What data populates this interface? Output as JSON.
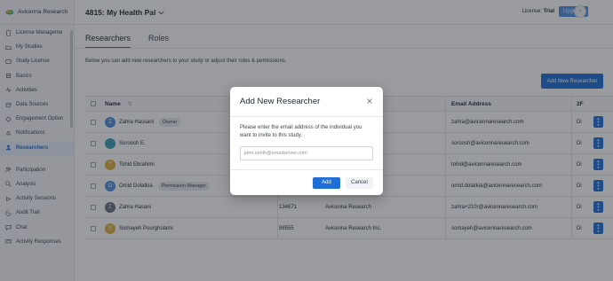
{
  "app": {
    "brand_name": "Avicenna Research",
    "study_title": "4815: My Health Pal",
    "license_label": "License:",
    "license_value": "Trial",
    "upgrade_label": "Upgrade",
    "accent": "#1f6fd6"
  },
  "sidebar": {
    "items": [
      {
        "label": "License Manageme",
        "icon": "document-icon"
      },
      {
        "label": "My Studies",
        "icon": "folder-icon"
      },
      {
        "label": "Study License",
        "icon": "license-icon"
      },
      {
        "label": "Basics",
        "icon": "basics-icon"
      },
      {
        "label": "Activities",
        "icon": "activities-icon"
      },
      {
        "label": "Data Sources",
        "icon": "data-sources-icon"
      },
      {
        "label": "Engagement Option",
        "icon": "engagement-icon"
      },
      {
        "label": "Notifications",
        "icon": "bell-icon"
      },
      {
        "label": "Researchers",
        "icon": "researchers-icon",
        "active": true
      },
      {
        "label": "Participation",
        "icon": "participation-icon"
      },
      {
        "label": "Analysis",
        "icon": "analysis-icon"
      },
      {
        "label": "Activity Sessions",
        "icon": "sessions-icon"
      },
      {
        "label": "Audit Trail",
        "icon": "audit-icon"
      },
      {
        "label": "Chat",
        "icon": "chat-icon"
      },
      {
        "label": "Activity Responses",
        "icon": "responses-icon"
      }
    ]
  },
  "tabs": [
    {
      "label": "Researchers",
      "active": true
    },
    {
      "label": "Roles",
      "active": false
    }
  ],
  "description": "Below you can add new researchers to your study or adjust their roles & permissions.",
  "add_new_label": "Add New Researcher",
  "table": {
    "columns": {
      "name": "Name",
      "email": "Email Address",
      "twofa": "2F"
    },
    "rows": [
      {
        "name": "Zahra Hassani",
        "role": "Owner",
        "id": "",
        "org": "",
        "email": "zahra@avicennaresearch.com",
        "twofa": "Di",
        "avatar_letter": "Z",
        "avatar_color": "#4f8fe0"
      },
      {
        "name": "Soroosh E.",
        "role": "",
        "id": "",
        "org": "",
        "email": "soroosh@avicennaresearch.com",
        "twofa": "Di",
        "avatar_letter": "",
        "avatar_color": "#3aa0b8"
      },
      {
        "name": "Tohid Ebrahimi",
        "role": "",
        "id": "",
        "org": "",
        "email": "tohid@avicennaresearch.com",
        "twofa": "Di",
        "avatar_letter": "T",
        "avatar_color": "#e0b03a"
      },
      {
        "name": "Omid Dolatkia",
        "role": "Permission Manager",
        "id": "",
        "org": "",
        "email": "omid.dolatkia@avicennaresearch.com",
        "twofa": "Di",
        "avatar_letter": "O",
        "avatar_color": "#4f8fe0"
      },
      {
        "name": "Zahra Hasani",
        "role": "",
        "id": "134671",
        "org": "Avicenna Research",
        "email": "zahra+210r@avicennaresearch.com",
        "twofa": "Di",
        "avatar_letter": "Z",
        "avatar_color": "#6b7280"
      },
      {
        "name": "Somayeh Pourgholami",
        "role": "",
        "id": "88555",
        "org": "Avicenna Research Inc.",
        "email": "somayeh@avicennaresearch.com",
        "twofa": "Di",
        "avatar_letter": "S",
        "avatar_color": "#e0b03a"
      }
    ]
  },
  "modal": {
    "title": "Add New Researcher",
    "text": "Please enter the email address of the individual you want to invite to this study.",
    "input_placeholder": "john.smith@emailserver.com",
    "add_label": "Add",
    "cancel_label": "Cancel"
  }
}
